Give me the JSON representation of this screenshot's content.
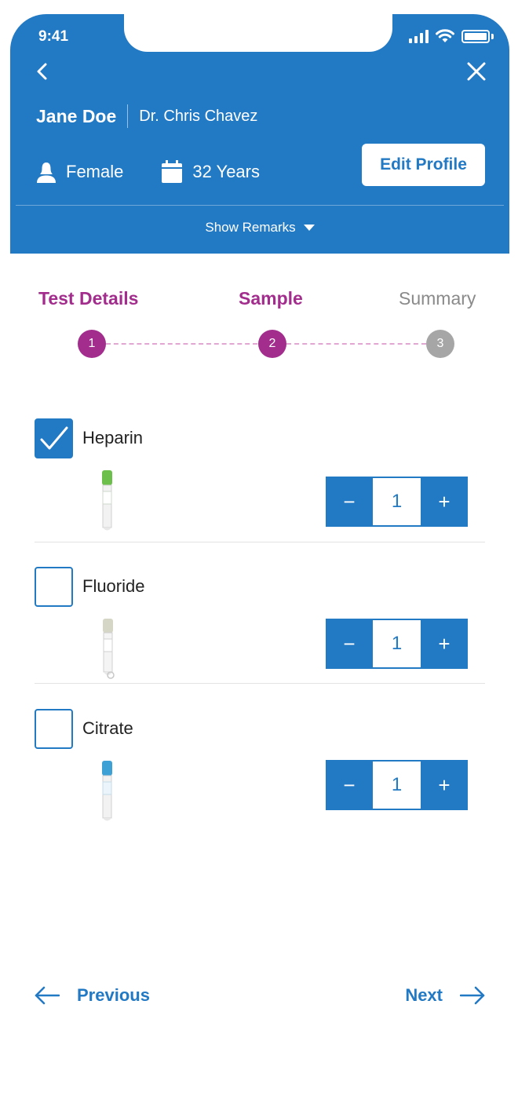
{
  "status_bar": {
    "time": "9:41",
    "icons": [
      "signal-icon",
      "wifi-icon",
      "battery-icon"
    ]
  },
  "header": {
    "patient_name": "Jane Doe",
    "doctor_name": "Dr. Chris Chavez",
    "gender": "Female",
    "age": "32 Years",
    "edit_profile_label": "Edit Profile",
    "show_remarks_label": "Show Remarks",
    "background_color": "#2279c4"
  },
  "stepper": {
    "steps": [
      {
        "label": "Test Details",
        "number": "1",
        "state": "done"
      },
      {
        "label": "Sample",
        "number": "2",
        "state": "done"
      },
      {
        "label": "Summary",
        "number": "3",
        "state": "todo"
      }
    ],
    "active_color": "#a22d8d",
    "inactive_color": "#a6a6a6"
  },
  "samples": [
    {
      "name": "Heparin",
      "checked": true,
      "quantity": "1",
      "tube_cap_color": "#6cbf4a",
      "minus": "−",
      "plus": "+"
    },
    {
      "name": "Fluoride",
      "checked": false,
      "quantity": "1",
      "tube_cap_color": "#d6d6c6",
      "minus": "−",
      "plus": "+"
    },
    {
      "name": "Citrate",
      "checked": false,
      "quantity": "1",
      "tube_cap_color": "#3ea1d6",
      "minus": "−",
      "plus": "+"
    }
  ],
  "navigation": {
    "previous_label": "Previous",
    "next_label": "Next"
  }
}
